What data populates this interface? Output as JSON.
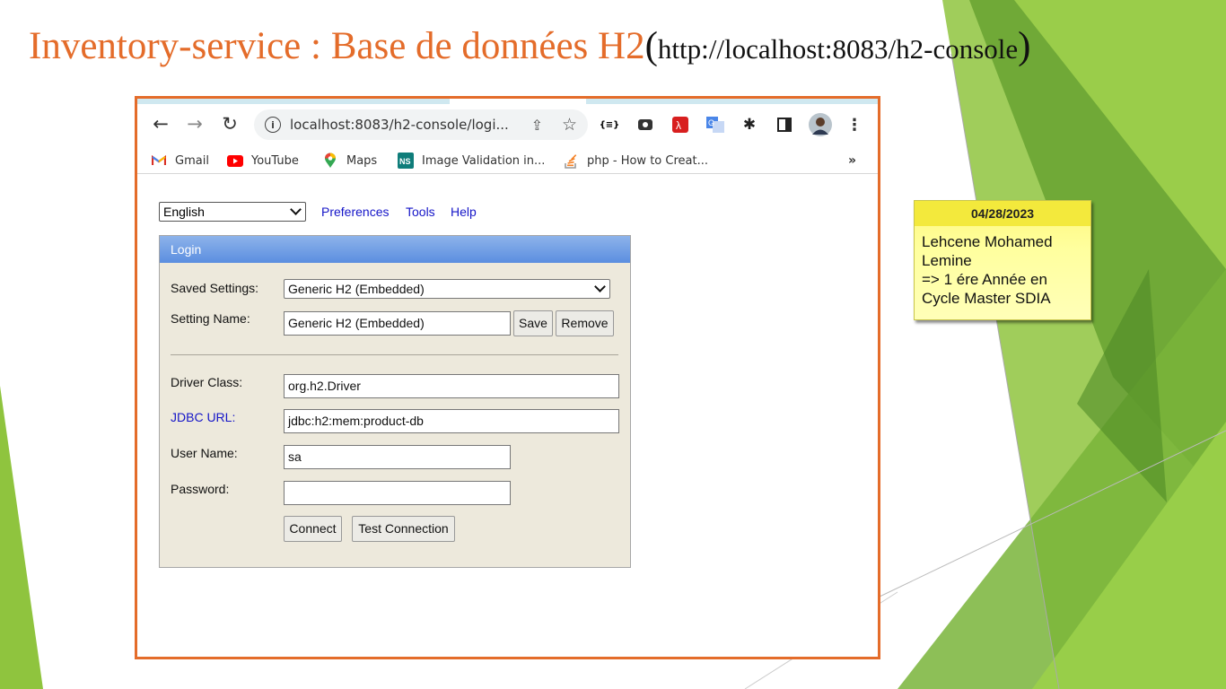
{
  "slide": {
    "title_main": "Inventory-service : Base de données H2",
    "title_paren_open": "(",
    "title_url": "http://localhost:8083/h2-console",
    "title_paren_close": ")"
  },
  "note": {
    "date": "04/28/2023",
    "text": "Lehcene Mohamed\nLemine\n=> 1 ére Année en\nCycle Master SDIA"
  },
  "browser": {
    "address": "localhost:8083/h2-console/logi...",
    "bookmarks": [
      {
        "icon": "gmail-icon",
        "label": "Gmail"
      },
      {
        "icon": "youtube-icon",
        "label": "YouTube"
      },
      {
        "icon": "maps-icon",
        "label": "Maps"
      },
      {
        "icon": "ns-icon",
        "label": "Image Validation in..."
      },
      {
        "icon": "stackoverflow-icon",
        "label": "php - How to Creat..."
      }
    ],
    "more": "»",
    "colors": {
      "accent_orange": "#e46c2a",
      "chrome_tab": "#cfe8f0"
    }
  },
  "h2": {
    "language": "English",
    "links": {
      "preferences": "Preferences",
      "tools": "Tools",
      "help": "Help"
    },
    "panel_title": "Login",
    "saved_settings_label": "Saved Settings:",
    "saved_settings_value": "Generic H2 (Embedded)",
    "setting_name_label": "Setting Name:",
    "setting_name_value": "Generic H2 (Embedded)",
    "save": "Save",
    "remove": "Remove",
    "driver_class_label": "Driver Class:",
    "driver_class_value": "org.h2.Driver",
    "jdbc_url_label": "JDBC URL:",
    "jdbc_url_value": "jdbc:h2:mem:product-db",
    "user_name_label": "User Name:",
    "user_name_value": "sa",
    "password_label": "Password:",
    "password_value": "",
    "connect": "Connect",
    "test_connection": "Test Connection"
  }
}
